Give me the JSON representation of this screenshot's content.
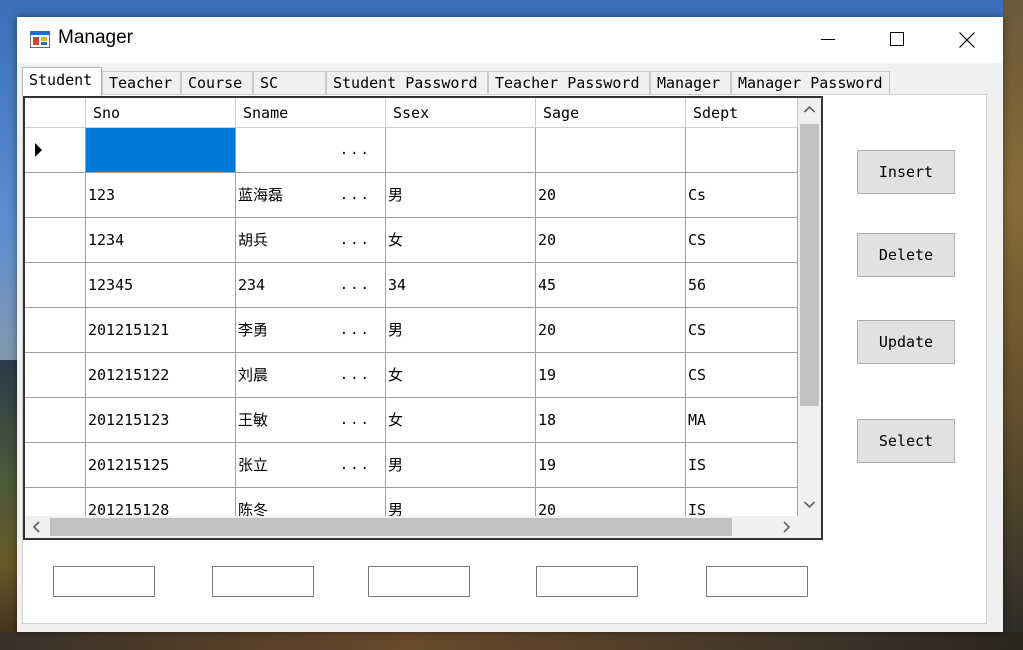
{
  "window": {
    "title": "Manager",
    "app_icon": "app-form-icon",
    "controls": [
      "minimize-icon",
      "maximize-icon",
      "close-icon"
    ]
  },
  "tabs": [
    {
      "label": "Student",
      "active": true
    },
    {
      "label": "Teacher",
      "active": false
    },
    {
      "label": "Course",
      "active": false
    },
    {
      "label": "SC",
      "active": false
    },
    {
      "label": "Student Password",
      "active": false
    },
    {
      "label": "Teacher Password",
      "active": false
    },
    {
      "label": "Manager",
      "active": false
    },
    {
      "label": "Manager Password",
      "active": false
    }
  ],
  "grid": {
    "columns": [
      "Sno",
      "Sname",
      "Ssex",
      "Sage",
      "Sdept"
    ],
    "ellipsis": "...",
    "rows": [
      {
        "sno": "",
        "sname": "",
        "ssex": "",
        "sage": "",
        "sdept": ""
      },
      {
        "sno": "123",
        "sname": "蓝海磊",
        "ssex": "男",
        "sage": "20",
        "sdept": "Cs"
      },
      {
        "sno": "1234",
        "sname": "胡兵",
        "ssex": "女",
        "sage": "20",
        "sdept": "CS"
      },
      {
        "sno": "12345",
        "sname": "234",
        "ssex": "34",
        "sage": "45",
        "sdept": "56"
      },
      {
        "sno": "201215121",
        "sname": "李勇",
        "ssex": "男",
        "sage": "20",
        "sdept": "CS"
      },
      {
        "sno": "201215122",
        "sname": "刘晨",
        "ssex": "女",
        "sage": "19",
        "sdept": "CS"
      },
      {
        "sno": "201215123",
        "sname": "王敏",
        "ssex": "女",
        "sage": "18",
        "sdept": "MA"
      },
      {
        "sno": "201215125",
        "sname": "张立",
        "ssex": "男",
        "sage": "19",
        "sdept": "IS"
      },
      {
        "sno": "201215128",
        "sname": "陈冬",
        "ssex": "男",
        "sage": "20",
        "sdept": "IS"
      }
    ]
  },
  "buttons": {
    "insert": "Insert",
    "delete": "Delete",
    "update": "Update",
    "select": "Select"
  },
  "textboxes": [
    "",
    "",
    "",
    "",
    ""
  ]
}
